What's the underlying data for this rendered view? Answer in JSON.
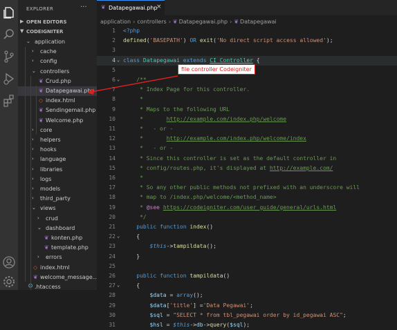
{
  "activity_bar": {
    "icons": [
      "files-icon",
      "search-icon",
      "source-control-icon",
      "run-debug-icon",
      "extensions-icon",
      "account-icon",
      "settings-gear-icon"
    ]
  },
  "sidebar": {
    "title": "EXPLORER",
    "more": "···",
    "open_editors": "OPEN EDITORS",
    "project": "CODEIGNITER",
    "tree": [
      {
        "label": "application",
        "depth": 1,
        "kind": "folder-open"
      },
      {
        "label": "cache",
        "depth": 2,
        "kind": "folder"
      },
      {
        "label": "config",
        "depth": 2,
        "kind": "folder"
      },
      {
        "label": "controllers",
        "depth": 2,
        "kind": "folder-open"
      },
      {
        "label": "Crud.php",
        "depth": 3,
        "kind": "php"
      },
      {
        "label": "Datapegawai.php",
        "depth": 3,
        "kind": "php",
        "selected": true
      },
      {
        "label": "index.html",
        "depth": 3,
        "kind": "html"
      },
      {
        "label": "Sendingemail.php",
        "depth": 3,
        "kind": "php"
      },
      {
        "label": "Welcome.php",
        "depth": 3,
        "kind": "php"
      },
      {
        "label": "core",
        "depth": 2,
        "kind": "folder"
      },
      {
        "label": "helpers",
        "depth": 2,
        "kind": "folder"
      },
      {
        "label": "hooks",
        "depth": 2,
        "kind": "folder"
      },
      {
        "label": "language",
        "depth": 2,
        "kind": "folder"
      },
      {
        "label": "libraries",
        "depth": 2,
        "kind": "folder"
      },
      {
        "label": "logs",
        "depth": 2,
        "kind": "folder"
      },
      {
        "label": "models",
        "depth": 2,
        "kind": "folder"
      },
      {
        "label": "third_party",
        "depth": 2,
        "kind": "folder"
      },
      {
        "label": "views",
        "depth": 2,
        "kind": "folder-open"
      },
      {
        "label": "crud",
        "depth": 3,
        "kind": "folder"
      },
      {
        "label": "dashboard",
        "depth": 3,
        "kind": "folder-open"
      },
      {
        "label": "konten.php",
        "depth": 4,
        "kind": "php"
      },
      {
        "label": "template.php",
        "depth": 4,
        "kind": "php"
      },
      {
        "label": "errors",
        "depth": 3,
        "kind": "folder"
      },
      {
        "label": "index.html",
        "depth": 2,
        "kind": "html"
      },
      {
        "label": "welcome_message....",
        "depth": 2,
        "kind": "php"
      },
      {
        "label": ".htaccess",
        "depth": 1,
        "kind": "gear"
      }
    ]
  },
  "tab": {
    "label": "Datapegawai.php",
    "close": "×"
  },
  "breadcrumb": [
    "application",
    "controllers",
    "Datapegawai.php",
    "Datapegawai"
  ],
  "annotation": "file controller Codeigniter",
  "code": {
    "lines": [
      {
        "n": "1",
        "segs": [
          [
            "k-tag",
            "<?php"
          ]
        ]
      },
      {
        "n": "2",
        "segs": [
          [
            "k-def",
            "defined"
          ],
          [
            "k-op",
            "("
          ],
          [
            "k-str",
            "'BASEPATH'"
          ],
          [
            "k-op",
            ") "
          ],
          [
            "k-kw",
            "OR"
          ],
          [
            "k-op",
            " "
          ],
          [
            "k-def",
            "exit"
          ],
          [
            "k-op",
            "("
          ],
          [
            "k-str",
            "'No direct script access allowed'"
          ],
          [
            "k-op",
            ");"
          ]
        ]
      },
      {
        "n": "3",
        "segs": []
      },
      {
        "n": "4",
        "segs": [
          [
            "k-kw",
            "class"
          ],
          [
            "k-op",
            " "
          ],
          [
            "k-cls",
            "Datapegawai"
          ],
          [
            "k-op",
            " "
          ],
          [
            "k-kw",
            "extends"
          ],
          [
            "k-op",
            " "
          ],
          [
            "k-ci",
            "CI_Controller"
          ],
          [
            "k-op",
            " {"
          ]
        ],
        "hl": true
      },
      {
        "n": "5",
        "segs": []
      },
      {
        "n": "6",
        "segs": [
          [
            "k-cm",
            "    /**"
          ]
        ]
      },
      {
        "n": "7",
        "segs": [
          [
            "k-cm",
            "     * Index Page for this controller."
          ]
        ]
      },
      {
        "n": "8",
        "segs": [
          [
            "k-cm",
            "     *"
          ]
        ]
      },
      {
        "n": "9",
        "segs": [
          [
            "k-cm",
            "     * Maps to the following URL"
          ]
        ]
      },
      {
        "n": "10",
        "segs": [
          [
            "k-cm",
            "     *       "
          ],
          [
            "k-url",
            "http://example.com/index.php/welcome"
          ]
        ]
      },
      {
        "n": "11",
        "segs": [
          [
            "k-cm",
            "     *   - or -"
          ]
        ]
      },
      {
        "n": "12",
        "segs": [
          [
            "k-cm",
            "     *       "
          ],
          [
            "k-url",
            "http://example.com/index.php/welcome/index"
          ]
        ]
      },
      {
        "n": "13",
        "segs": [
          [
            "k-cm",
            "     *   - or -"
          ]
        ]
      },
      {
        "n": "14",
        "segs": [
          [
            "k-cm",
            "     * Since this controller is set as the default controller in"
          ]
        ]
      },
      {
        "n": "15",
        "segs": [
          [
            "k-cm",
            "     * config/routes.php, it's displayed at "
          ],
          [
            "k-url",
            "http://example.com/"
          ]
        ]
      },
      {
        "n": "16",
        "segs": [
          [
            "k-cm",
            "     *"
          ]
        ]
      },
      {
        "n": "17",
        "segs": [
          [
            "k-cm",
            "     * So any other public methods not prefixed with an underscore will"
          ]
        ]
      },
      {
        "n": "18",
        "segs": [
          [
            "k-cm",
            "     * map to /index.php/welcome/<method_name>"
          ]
        ]
      },
      {
        "n": "19",
        "segs": [
          [
            "k-cm",
            "     * "
          ],
          [
            "k-kw2",
            "@see"
          ],
          [
            "k-cm",
            " "
          ],
          [
            "k-url",
            "https://codeigniter.com/user_guide/general/urls.html"
          ]
        ]
      },
      {
        "n": "20",
        "segs": [
          [
            "k-cm",
            "     */"
          ]
        ]
      },
      {
        "n": "21",
        "segs": [
          [
            "k-kw",
            "    public"
          ],
          [
            "k-op",
            " "
          ],
          [
            "k-kw",
            "function"
          ],
          [
            "k-op",
            " "
          ],
          [
            "k-fn",
            "index"
          ],
          [
            "k-op",
            "()"
          ]
        ]
      },
      {
        "n": "22",
        "segs": [
          [
            "k-op",
            "    {"
          ]
        ]
      },
      {
        "n": "23",
        "segs": [
          [
            "k-op",
            "        "
          ],
          [
            "k-this",
            "$this"
          ],
          [
            "k-op",
            "->"
          ],
          [
            "k-fn",
            "tampildata"
          ],
          [
            "k-op",
            "();"
          ]
        ]
      },
      {
        "n": "24",
        "segs": [
          [
            "k-op",
            "    }"
          ]
        ]
      },
      {
        "n": "25",
        "segs": []
      },
      {
        "n": "26",
        "segs": [
          [
            "k-kw",
            "    public"
          ],
          [
            "k-op",
            " "
          ],
          [
            "k-kw",
            "function"
          ],
          [
            "k-op",
            " "
          ],
          [
            "k-fn",
            "tampildata"
          ],
          [
            "k-op",
            "()"
          ]
        ]
      },
      {
        "n": "27",
        "segs": [
          [
            "k-op",
            "    {"
          ]
        ]
      },
      {
        "n": "28",
        "segs": [
          [
            "k-op",
            "        "
          ],
          [
            "k-var",
            "$data"
          ],
          [
            "k-op",
            " = "
          ],
          [
            "k-kw",
            "array"
          ],
          [
            "k-op",
            "();"
          ]
        ]
      },
      {
        "n": "29",
        "segs": [
          [
            "k-op",
            "        "
          ],
          [
            "k-var",
            "$data"
          ],
          [
            "k-op",
            "["
          ],
          [
            "k-str",
            "'title'"
          ],
          [
            "k-op",
            "] ="
          ],
          [
            "k-str",
            "'Data Pegawai'"
          ],
          [
            "k-op",
            ";"
          ]
        ]
      },
      {
        "n": "30",
        "segs": [
          [
            "k-op",
            "        "
          ],
          [
            "k-var",
            "$sql"
          ],
          [
            "k-op",
            " = "
          ],
          [
            "k-str",
            "\"SELECT * from tbl_pegawai order by id_pegawai ASC\""
          ],
          [
            "k-op",
            ";"
          ]
        ]
      },
      {
        "n": "31",
        "segs": [
          [
            "k-op",
            "        "
          ],
          [
            "k-var",
            "$hsl"
          ],
          [
            "k-op",
            " = "
          ],
          [
            "k-this",
            "$this"
          ],
          [
            "k-op",
            "->"
          ],
          [
            "k-var",
            "db"
          ],
          [
            "k-op",
            "->"
          ],
          [
            "k-fn",
            "query"
          ],
          [
            "k-op",
            "("
          ],
          [
            "k-var",
            "$sql"
          ],
          [
            "k-op",
            ");"
          ]
        ]
      }
    ]
  }
}
